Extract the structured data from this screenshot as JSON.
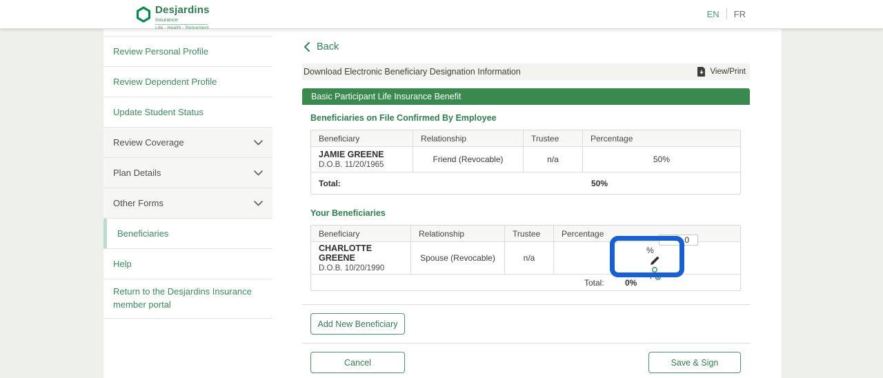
{
  "brand": {
    "name": "Desjardins",
    "division": "Insurance",
    "tagline": "Life · Health · Retirement",
    "green": "#00874e"
  },
  "language": {
    "en": "EN",
    "fr": "FR"
  },
  "sidebar": {
    "items": [
      {
        "label": "Review Personal Profile",
        "type": "link"
      },
      {
        "label": "Review Dependent Profile",
        "type": "link"
      },
      {
        "label": "Update Student Status",
        "type": "link"
      },
      {
        "label": "Review Coverage",
        "type": "accordion"
      },
      {
        "label": "Plan Details",
        "type": "accordion"
      },
      {
        "label": "Other Forms",
        "type": "accordion"
      },
      {
        "label": "Beneficiaries",
        "type": "link",
        "active": true
      },
      {
        "label": "Help",
        "type": "link"
      },
      {
        "label": "Return to the Desjardins Insurance member portal",
        "type": "link"
      }
    ]
  },
  "main": {
    "back_label": "Back",
    "download_bar": {
      "label": "Download Electronic Beneficiary Designation Information",
      "action_label": "View/Print"
    },
    "banner_title": "Basic Participant Life Insurance Benefit",
    "confirmed_table": {
      "heading": "Beneficiaries on File Confirmed By Employee",
      "columns": [
        "Beneficiary",
        "Relationship",
        "Trustee",
        "Percentage"
      ],
      "row": {
        "name": "JAMIE GREENE",
        "dob": "D.O.B. 11/20/1965",
        "relationship": "Friend (Revocable)",
        "trustee": "n/a",
        "percentage": "50%"
      },
      "total_label": "Total:",
      "total_value": "50%"
    },
    "your_table": {
      "heading": "Your Beneficiaries",
      "columns": [
        "Beneficiary",
        "Relationship",
        "Trustee",
        "Percentage"
      ],
      "row": {
        "name": "CHARLOTTE GREENE",
        "dob": "D.O.B. 10/20/1990",
        "relationship": "Spouse (Revocable)",
        "trustee": "n/a",
        "percentage_value": "0",
        "percentage_unit": "%"
      },
      "total_label": "Total:",
      "total_value": "0%"
    },
    "actions": {
      "add": "Add New Beneficiary",
      "cancel": "Cancel",
      "save": "Save & Sign"
    }
  },
  "annotation": {
    "highlight_color": "#1a5fd0"
  }
}
